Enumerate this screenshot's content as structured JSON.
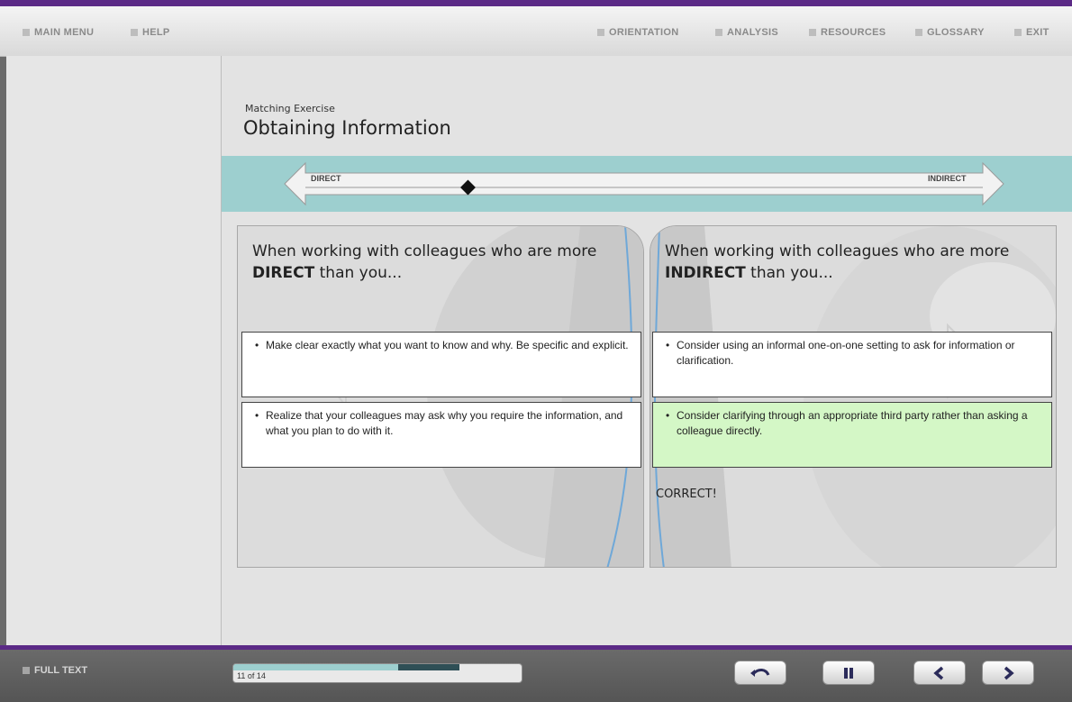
{
  "header": {
    "left_nav": [
      {
        "label": "MAIN MENU"
      },
      {
        "label": "HELP"
      }
    ],
    "right_nav": [
      {
        "label": "ORIENTATION"
      },
      {
        "label": "ANALYSIS"
      },
      {
        "label": "RESOURCES"
      },
      {
        "label": "GLOSSARY"
      },
      {
        "label": "EXIT"
      }
    ]
  },
  "page": {
    "subtitle": "Matching Exercise",
    "title": "Obtaining Information"
  },
  "scale": {
    "left_label": "DIRECT",
    "right_label": "INDIRECT",
    "marker_position": 0.24
  },
  "panels": {
    "left": {
      "heading_pre": "When working with colleagues who are more ",
      "heading_bold": "DIRECT",
      "heading_post": " than you...",
      "cards": [
        {
          "bullet": "•",
          "text": "Make clear exactly what you want to know and why. Be specific and explicit."
        },
        {
          "bullet": "•",
          "text": "Realize that your colleagues may ask why you require the information, and what you plan to do with it."
        }
      ]
    },
    "right": {
      "heading_pre": "When working with colleagues who are more ",
      "heading_bold": "INDIRECT",
      "heading_post": " than you...",
      "cards": [
        {
          "bullet": "•",
          "text": "Consider using an informal one-on-one setting to ask for information or clarification."
        },
        {
          "bullet": "•",
          "text": "Consider clarifying through an appropriate third party rather than asking a colleague directly."
        }
      ],
      "feedback": "CORRECT!"
    }
  },
  "footer": {
    "full_text_label": "FULL TEXT",
    "progress_label": "11 of 14",
    "progress_current": 11,
    "progress_total": 14,
    "controls": [
      "replay-icon",
      "pause-icon",
      "previous-icon",
      "next-icon"
    ]
  },
  "colors": {
    "accent_purple": "#5b2a86",
    "band_teal": "#9dcfcf",
    "correct_green": "#d4f7c6"
  }
}
